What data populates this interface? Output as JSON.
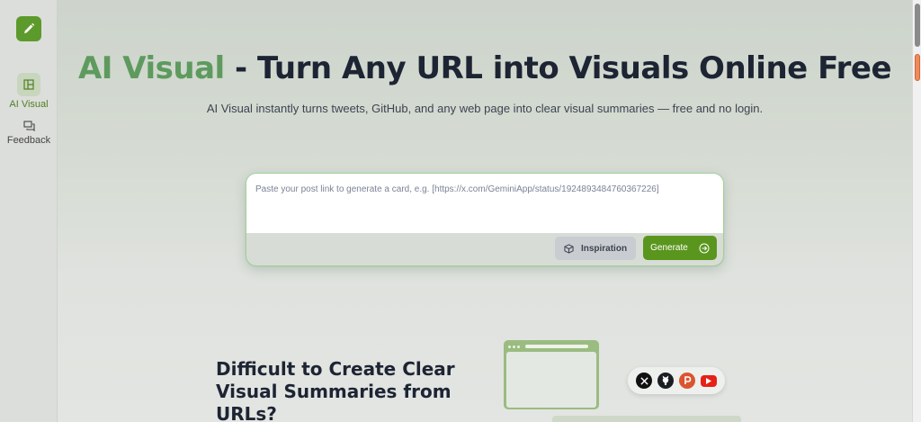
{
  "sidebar": {
    "items": [
      {
        "label": "AI Visual",
        "icon": "layout-panel-icon",
        "active": true
      },
      {
        "label": "Feedback",
        "icon": "feedback-chat-icon",
        "active": false
      }
    ]
  },
  "hero": {
    "title_accent": "AI Visual",
    "title_rest": " - Turn Any URL into Visuals Online Free",
    "subtitle": "AI Visual instantly turns tweets, GitHub, and any web page into clear visual summaries — free and no login."
  },
  "input": {
    "placeholder": "Paste your post link to generate a card, e.g. [https://x.com/GeminiApp/status/1924893484760367226]",
    "value": ""
  },
  "actions": {
    "inspiration_label": "Inspiration",
    "generate_label": "Generate"
  },
  "section": {
    "title": "Difficult to Create Clear Visual Summaries from URLs?"
  },
  "social_icons": [
    "x-icon",
    "github-icon",
    "producthunt-icon",
    "youtube-icon"
  ],
  "colors": {
    "brand_green": "#5a961d",
    "accent_title": "#5e9a5e",
    "youtube_red": "#e62117",
    "producthunt": "#da552f"
  }
}
